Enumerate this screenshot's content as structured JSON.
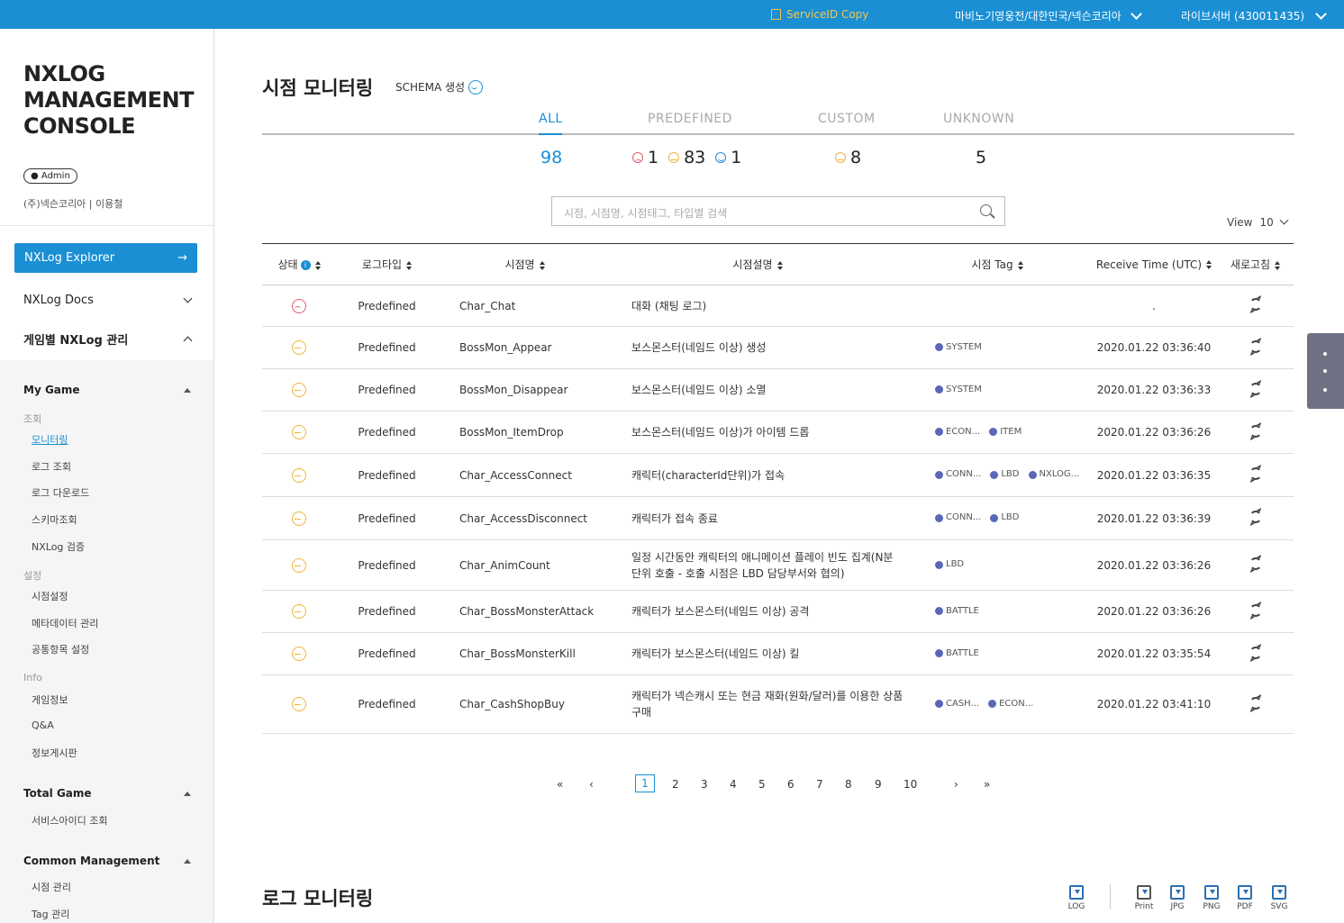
{
  "topbar": {
    "copy_label": "ServiceID Copy",
    "org_label": "마비노기영웅전/대한민국/넥슨코리아",
    "server_label": "라이브서버 (430011435)"
  },
  "sidebar": {
    "brand": "NXLOG MANAGEMENT CONSOLE",
    "role_badge": "Admin",
    "user": "(주)넥슨코리아 | 이용철",
    "explorer_label": "NXLog Explorer",
    "docs_label": "NXLog Docs",
    "game_mgmt_label": "게임별 NXLog 관리",
    "sections": {
      "my_game": "My Game",
      "cat_query": "조회",
      "monitoring": "모니터링",
      "log_query": "로그 조회",
      "log_download": "로그 다운로드",
      "schema_query": "스키마조회",
      "nxlog_verify": "NXLog 검증",
      "cat_settings": "설정",
      "point_settings": "시점설정",
      "metadata_mgmt": "메타데이터 관리",
      "common_settings": "공통항목 설정",
      "cat_info": "Info",
      "game_info": "게임정보",
      "qa": "Q&A",
      "info_board": "정보게시판",
      "total_game": "Total Game",
      "serviceid_query": "서비스아이디 조회",
      "common_mgmt": "Common Management",
      "point_mgmt": "시점 관리",
      "tag_mgmt": "Tag 관리"
    }
  },
  "main": {
    "title": "시점 모니터링",
    "schema_label": "SCHEMA 생성",
    "tabs": [
      "ALL",
      "PREDEFINED",
      "CUSTOM",
      "UNKNOWN"
    ],
    "counts": {
      "all": "98",
      "predefined_bad": "1",
      "predefined_warn": "83",
      "predefined_good": "1",
      "custom_warn": "8",
      "unknown": "5"
    },
    "search_placeholder": "시점, 시점명, 시점태그, 타입별 검색",
    "view_label": "View",
    "view_value": "10",
    "columns": [
      "상태",
      "로그타입",
      "시점명",
      "시점설명",
      "시점 Tag",
      "Receive Time (UTC)",
      "새로고침"
    ],
    "rows": [
      {
        "status": "bad",
        "type": "Predefined",
        "name": "Char_Chat",
        "desc": "대화 (채팅 로그)",
        "tags": [],
        "time": "."
      },
      {
        "status": "warn",
        "type": "Predefined",
        "name": "BossMon_Appear",
        "desc": "보스몬스터(네임드 이상) 생성",
        "tags": [
          "SYSTEM"
        ],
        "time": "2020.01.22 03:36:40"
      },
      {
        "status": "warn",
        "type": "Predefined",
        "name": "BossMon_Disappear",
        "desc": "보스몬스터(네임드 이상) 소멸",
        "tags": [
          "SYSTEM"
        ],
        "time": "2020.01.22 03:36:33"
      },
      {
        "status": "warn",
        "type": "Predefined",
        "name": "BossMon_ItemDrop",
        "desc": "보스몬스터(네임드 이상)가 아이템 드롭",
        "tags": [
          "ECON...",
          "ITEM"
        ],
        "time": "2020.01.22 03:36:26"
      },
      {
        "status": "warn",
        "type": "Predefined",
        "name": "Char_AccessConnect",
        "desc": "캐릭터(characterId단위)가 접속",
        "tags": [
          "CONN...",
          "LBD",
          "NXLOG..."
        ],
        "time": "2020.01.22 03:36:35"
      },
      {
        "status": "warn",
        "type": "Predefined",
        "name": "Char_AccessDisconnect",
        "desc": "캐릭터가 접속 종료",
        "tags": [
          "CONN...",
          "LBD"
        ],
        "time": "2020.01.22 03:36:39"
      },
      {
        "status": "warn",
        "type": "Predefined",
        "name": "Char_AnimCount",
        "desc": "일정 시간동안 캐릭터의 애니메이션 플레이 빈도 집계(N분 단위 호출 - 호출 시점은 LBD 담당부서와 협의)",
        "tags": [
          "LBD"
        ],
        "time": "2020.01.22 03:36:26"
      },
      {
        "status": "warn",
        "type": "Predefined",
        "name": "Char_BossMonsterAttack",
        "desc": "캐릭터가 보스몬스터(네임드 이상) 공격",
        "tags": [
          "BATTLE"
        ],
        "time": "2020.01.22 03:36:26"
      },
      {
        "status": "warn",
        "type": "Predefined",
        "name": "Char_BossMonsterKill",
        "desc": "캐릭터가 보스몬스터(네임드 이상) 킬",
        "tags": [
          "BATTLE"
        ],
        "time": "2020.01.22 03:35:54"
      },
      {
        "status": "warn",
        "type": "Predefined",
        "name": "Char_CashShopBuy",
        "desc": "캐릭터가 넥슨캐시 또는 현금 재화(원화/달러)를 이용한 상품 구매",
        "tags": [
          "CASH...",
          "ECON..."
        ],
        "time": "2020.01.22 03:41:10"
      }
    ],
    "pager": {
      "first": "«",
      "prev": "‹",
      "pages": [
        "1",
        "2",
        "3",
        "4",
        "5",
        "6",
        "7",
        "8",
        "9",
        "10"
      ],
      "next": "›",
      "last": "»"
    },
    "log_title": "로그 모니터링",
    "tools": [
      "LOG",
      "Print",
      "JPG",
      "PNG",
      "PDF",
      "SVG"
    ]
  }
}
